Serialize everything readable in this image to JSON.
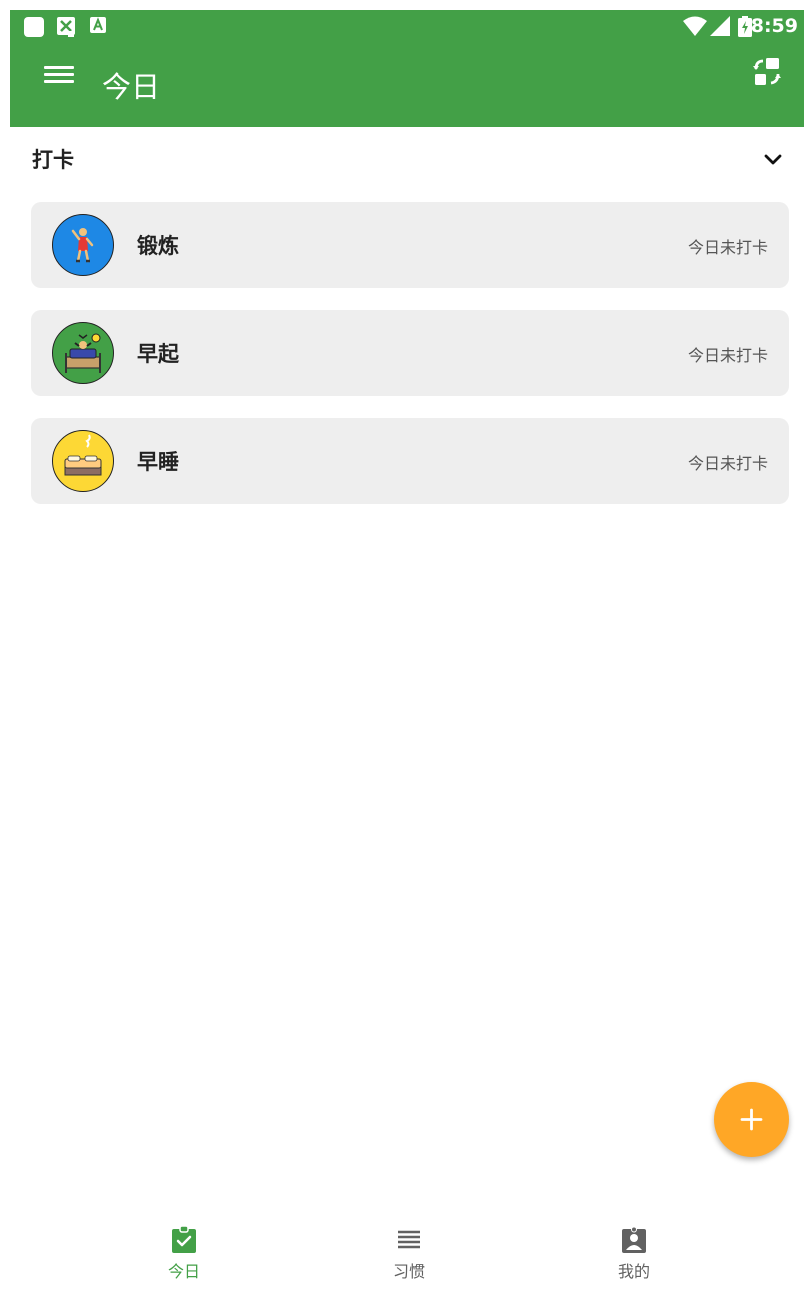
{
  "status_bar": {
    "time": "8:59",
    "icons": [
      "app-icon",
      "image-icon",
      "a-icon",
      "wifi-icon",
      "signal-icon",
      "battery-icon"
    ]
  },
  "app_bar": {
    "title": "今日",
    "menu_icon": "menu-icon",
    "action_icon": "sync-icon"
  },
  "section": {
    "title": "打卡",
    "toggle_icon": "chevron-down-icon"
  },
  "habits": [
    {
      "name": "锻炼",
      "status": "今日未打卡",
      "icon_bg": "#1e88e5",
      "icon": "exercise-icon"
    },
    {
      "name": "早起",
      "status": "今日未打卡",
      "icon_bg": "#43a047",
      "icon": "wake-up-icon"
    },
    {
      "name": "早睡",
      "status": "今日未打卡",
      "icon_bg": "#fdd835",
      "icon": "sleep-icon"
    }
  ],
  "fab": {
    "icon": "plus-icon"
  },
  "bottom_nav": [
    {
      "label": "今日",
      "icon": "clipboard-check-icon",
      "active": true
    },
    {
      "label": "习惯",
      "icon": "list-icon",
      "active": false
    },
    {
      "label": "我的",
      "icon": "profile-icon",
      "active": false
    }
  ],
  "colors": {
    "primary": "#43a047",
    "accent": "#ffa726",
    "card_bg": "#eeeeee",
    "nav_active": "#43a047",
    "nav_inactive": "#616161"
  }
}
